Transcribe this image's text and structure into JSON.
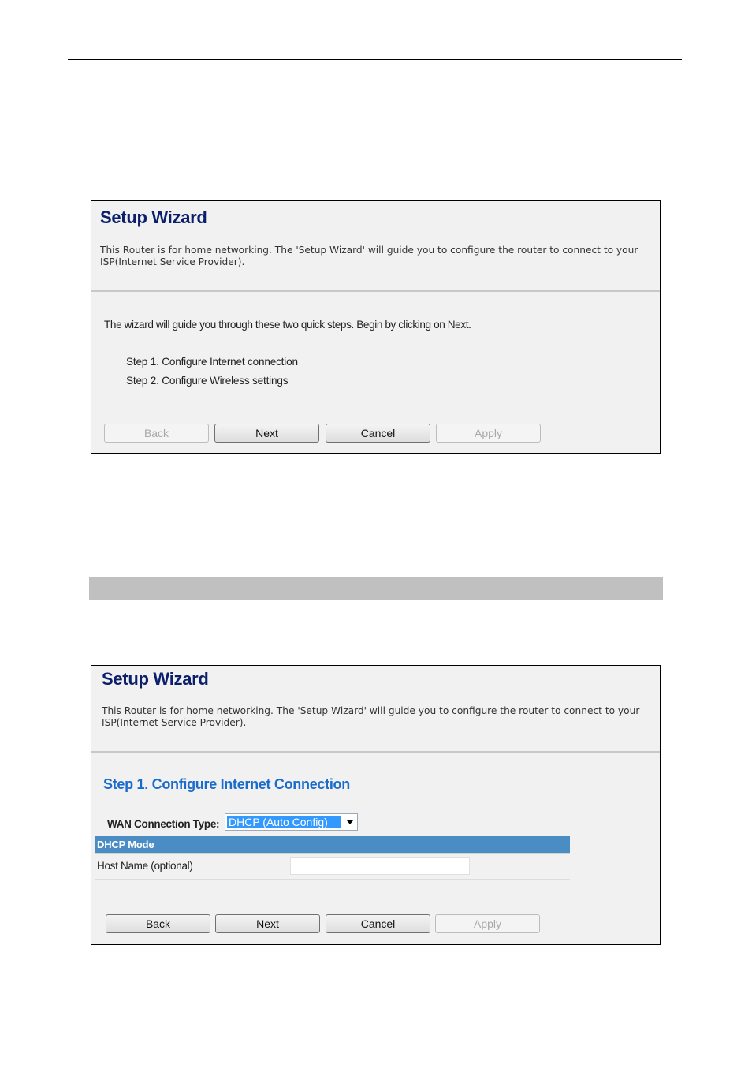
{
  "wizard_title": "Setup Wizard",
  "wizard_description": "This Router is for home networking. The 'Setup Wizard' will guide you to configure the router to connect to your ISP(Internet Service Provider).",
  "panel1": {
    "intro": "The wizard will guide you through these two quick steps. Begin by clicking on Next.",
    "steps": [
      "Step 1. Configure Internet connection",
      "Step 2. Configure Wireless settings"
    ],
    "buttons": {
      "back": {
        "label": "Back",
        "enabled": false
      },
      "next": {
        "label": "Next",
        "enabled": true
      },
      "cancel": {
        "label": "Cancel",
        "enabled": true
      },
      "apply": {
        "label": "Apply",
        "enabled": false
      }
    }
  },
  "panel2": {
    "step_heading": "Step 1. Configure Internet Connection",
    "wan_label": "WAN Connection Type:",
    "wan_selected": "DHCP (Auto Config)",
    "dhcp_section_title": "DHCP Mode",
    "host_name_label": "Host Name (optional)",
    "host_name_value": "",
    "buttons": {
      "back": {
        "label": "Back",
        "enabled": true
      },
      "next": {
        "label": "Next",
        "enabled": true
      },
      "cancel": {
        "label": "Cancel",
        "enabled": true
      },
      "apply": {
        "label": "Apply",
        "enabled": false
      }
    }
  },
  "colors": {
    "title": "#0b1f6b",
    "step_heading": "#1a6ccc",
    "dhcp_header": "#4a8cc4",
    "panel_bg": "#f1f1f1",
    "section_bar": "#c0c0c0"
  }
}
